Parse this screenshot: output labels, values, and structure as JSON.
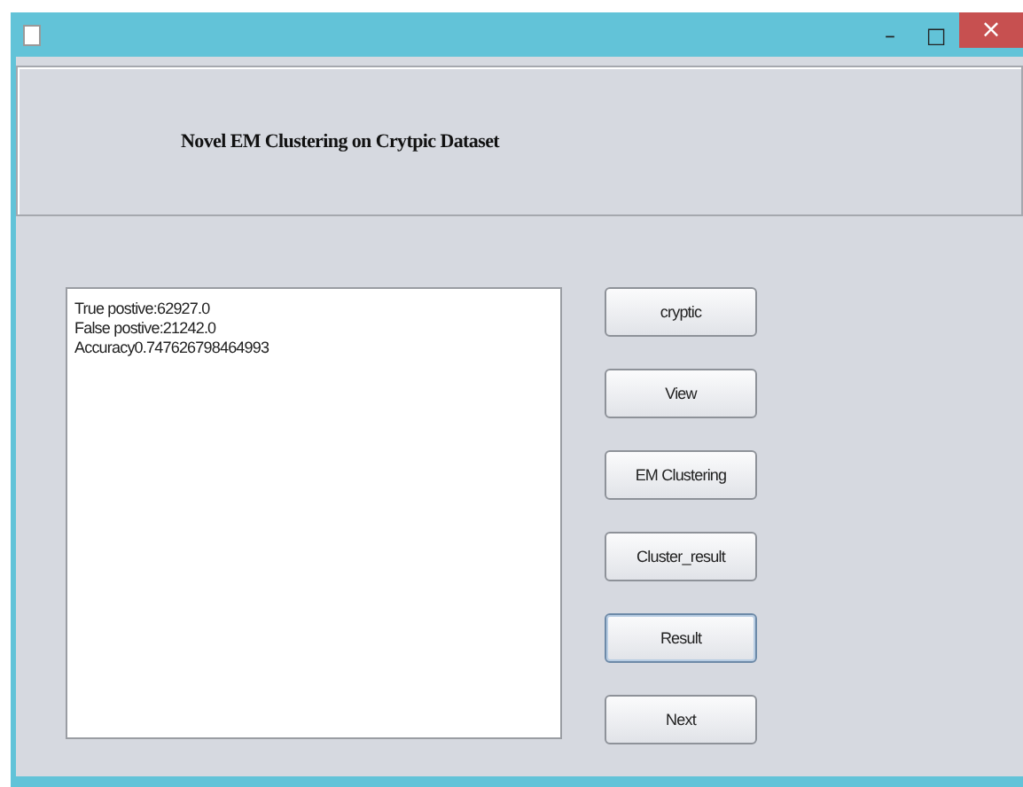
{
  "window": {
    "title_bar": {
      "minimize": "–",
      "maximize": "□",
      "close": "×"
    }
  },
  "header": {
    "title": "Novel EM Clustering on Crytpic Dataset"
  },
  "output": {
    "lines": [
      "True postive:62927.0",
      "False postive:21242.0",
      "Accuracy0.747626798464993"
    ]
  },
  "buttons": [
    {
      "label": "cryptic",
      "focused": false
    },
    {
      "label": "View",
      "focused": false
    },
    {
      "label": "EM Clustering",
      "focused": false
    },
    {
      "label": "Cluster_result",
      "focused": false
    },
    {
      "label": "Result",
      "focused": true
    },
    {
      "label": "Next",
      "focused": false
    }
  ]
}
